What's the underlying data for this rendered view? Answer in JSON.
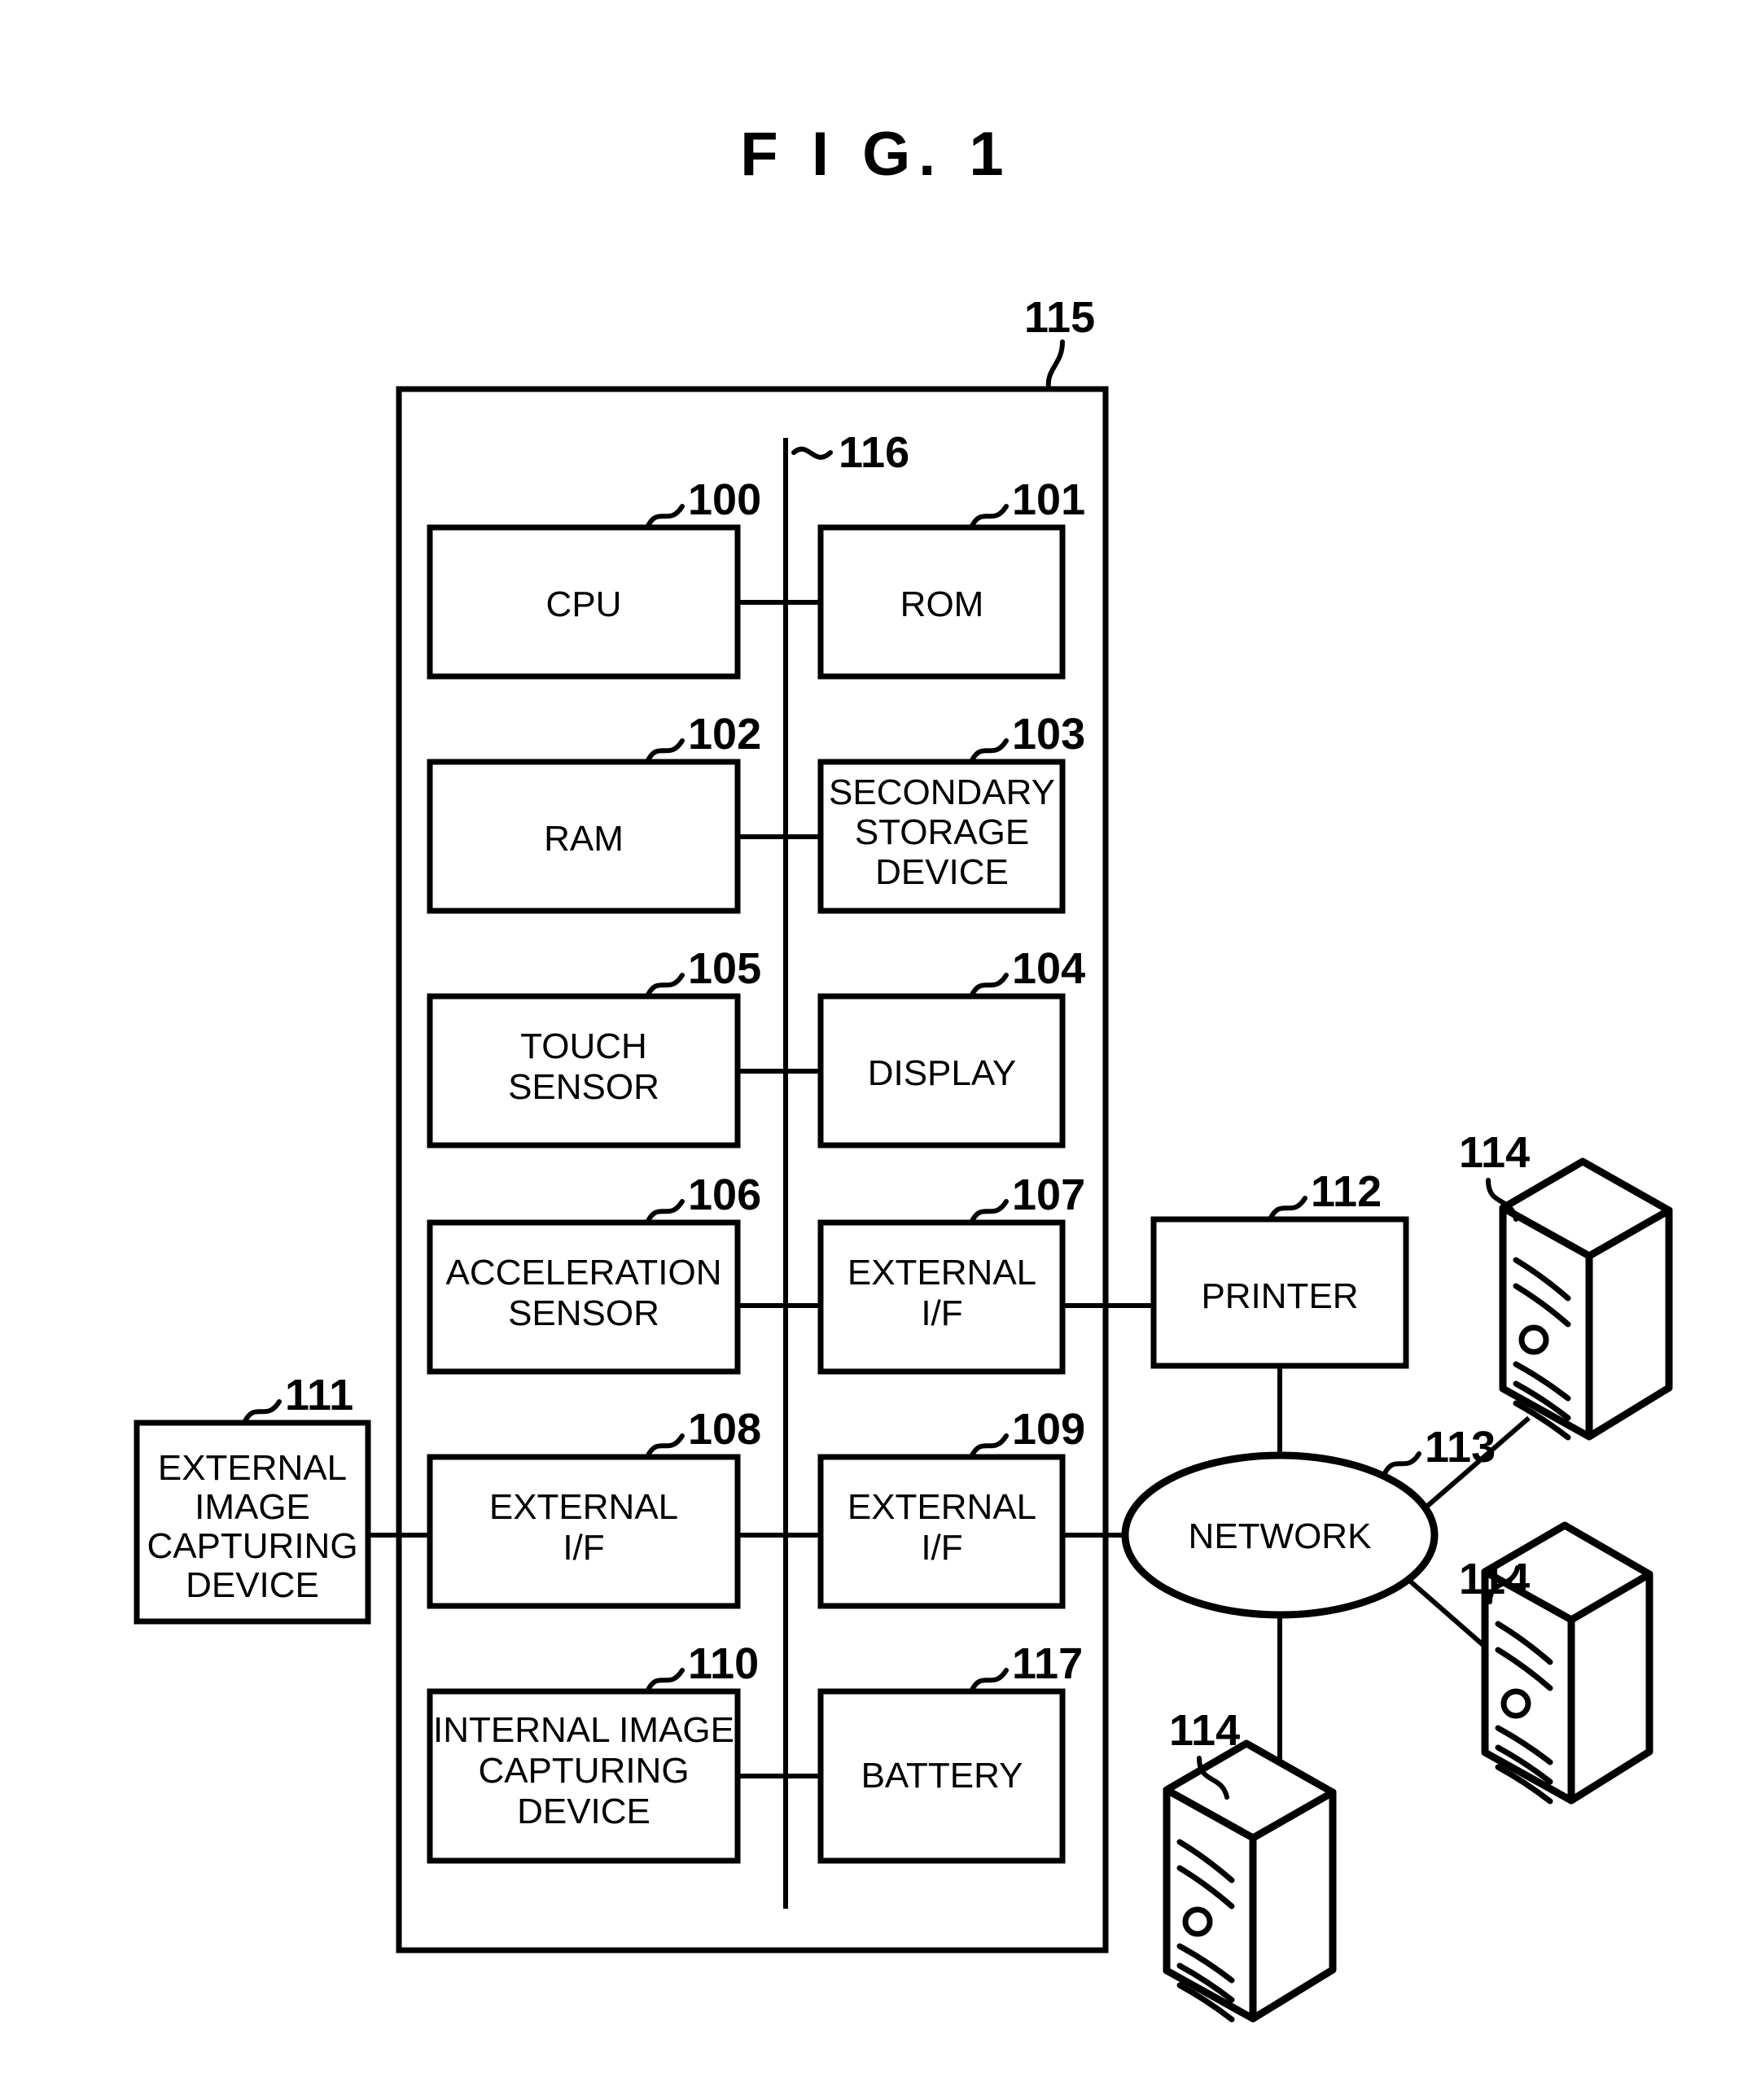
{
  "figure": {
    "title": "F I G. 1",
    "type": "patent-block-diagram"
  },
  "device_container": {
    "ref": "115",
    "bus": {
      "ref": "116",
      "name": "system-bus"
    }
  },
  "blocks": [
    {
      "id": "cpu",
      "ref": "100",
      "lines": [
        "CPU"
      ],
      "column": "left"
    },
    {
      "id": "rom",
      "ref": "101",
      "lines": [
        "ROM"
      ],
      "column": "right"
    },
    {
      "id": "ram",
      "ref": "102",
      "lines": [
        "RAM"
      ],
      "column": "left"
    },
    {
      "id": "secondary",
      "ref": "103",
      "lines": [
        "SECONDARY",
        "STORAGE",
        "DEVICE"
      ],
      "column": "right"
    },
    {
      "id": "display",
      "ref": "104",
      "lines": [
        "DISPLAY"
      ],
      "column": "right"
    },
    {
      "id": "touch-sensor",
      "ref": "105",
      "lines": [
        "TOUCH",
        "SENSOR"
      ],
      "column": "left"
    },
    {
      "id": "accel-sensor",
      "ref": "106",
      "lines": [
        "ACCELERATION",
        "SENSOR"
      ],
      "column": "left"
    },
    {
      "id": "ext-if-107",
      "ref": "107",
      "lines": [
        "EXTERNAL",
        "I/F"
      ],
      "column": "right"
    },
    {
      "id": "ext-if-108",
      "ref": "108",
      "lines": [
        "EXTERNAL",
        "I/F"
      ],
      "column": "left"
    },
    {
      "id": "ext-if-109",
      "ref": "109",
      "lines": [
        "EXTERNAL",
        "I/F"
      ],
      "column": "right"
    },
    {
      "id": "internal-cam",
      "ref": "110",
      "lines": [
        "INTERNAL IMAGE",
        "CAPTURING",
        "DEVICE"
      ],
      "column": "left"
    },
    {
      "id": "battery",
      "ref": "117",
      "lines": [
        "BATTERY"
      ],
      "column": "right"
    },
    {
      "id": "external-cam",
      "ref": "111",
      "lines": [
        "EXTERNAL",
        "IMAGE",
        "CAPTURING",
        "DEVICE"
      ],
      "column": "outside-left"
    },
    {
      "id": "printer",
      "ref": "112",
      "lines": [
        "PRINTER"
      ],
      "column": "outside-right"
    }
  ],
  "network": {
    "ref": "113",
    "label": "NETWORK"
  },
  "computers": [
    {
      "id": "computer-top",
      "ref": "114"
    },
    {
      "id": "computer-right",
      "ref": "114"
    },
    {
      "id": "computer-bottom",
      "ref": "114"
    }
  ],
  "labels": {
    "cpu": "CPU",
    "rom": "ROM",
    "ram": "RAM",
    "secondary_1": "SECONDARY",
    "secondary_2": "STORAGE",
    "secondary_3": "DEVICE",
    "touch_1": "TOUCH",
    "touch_2": "SENSOR",
    "display": "DISPLAY",
    "accel_1": "ACCELERATION",
    "accel_2": "SENSOR",
    "extif107_1": "EXTERNAL",
    "extif107_2": "I/F",
    "extif108_1": "EXTERNAL",
    "extif108_2": "I/F",
    "extif109_1": "EXTERNAL",
    "extif109_2": "I/F",
    "intcam_1": "INTERNAL IMAGE",
    "intcam_2": "CAPTURING",
    "intcam_3": "DEVICE",
    "battery": "BATTERY",
    "extcam_1": "EXTERNAL",
    "extcam_2": "IMAGE",
    "extcam_3": "CAPTURING",
    "extcam_4": "DEVICE",
    "printer": "PRINTER",
    "network": "NETWORK"
  },
  "refs": {
    "r100": "100",
    "r101": "101",
    "r102": "102",
    "r103": "103",
    "r104": "104",
    "r105": "105",
    "r106": "106",
    "r107": "107",
    "r108": "108",
    "r109": "109",
    "r110": "110",
    "r111": "111",
    "r112": "112",
    "r113": "113",
    "r114a": "114",
    "r114b": "114",
    "r114c": "114",
    "r115": "115",
    "r116": "116",
    "r117": "117"
  },
  "colors": {
    "ink": "#000000",
    "paper": "#ffffff"
  }
}
